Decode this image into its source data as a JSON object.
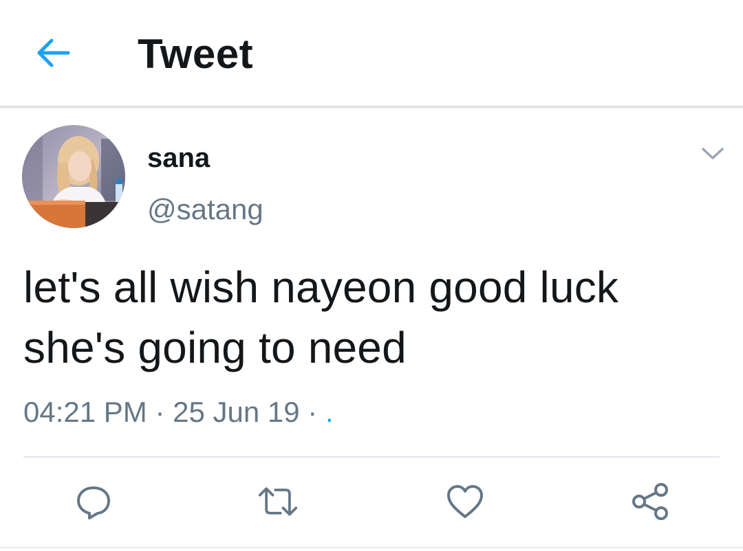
{
  "header": {
    "title": "Tweet",
    "back_icon": "arrow-left-icon"
  },
  "tweet": {
    "author": {
      "display_name": "sana",
      "handle": "@satang",
      "avatar": "profile-photo"
    },
    "menu_icon": "chevron-down-icon",
    "text_line_1": "let's all wish nayeon good luck",
    "text_line_2": "she's going to need",
    "time": "04:21 PM",
    "separator_1": "·",
    "date": "25 Jun 19",
    "separator_2": "·",
    "source": "."
  },
  "actions": [
    {
      "name": "reply",
      "icon": "reply-icon"
    },
    {
      "name": "retweet",
      "icon": "retweet-icon"
    },
    {
      "name": "like",
      "icon": "heart-icon"
    },
    {
      "name": "share",
      "icon": "share-icon"
    }
  ],
  "colors": {
    "accent": "#1da1f2",
    "text": "#14171a",
    "secondary": "#657786",
    "divider": "#e1e8ed"
  }
}
